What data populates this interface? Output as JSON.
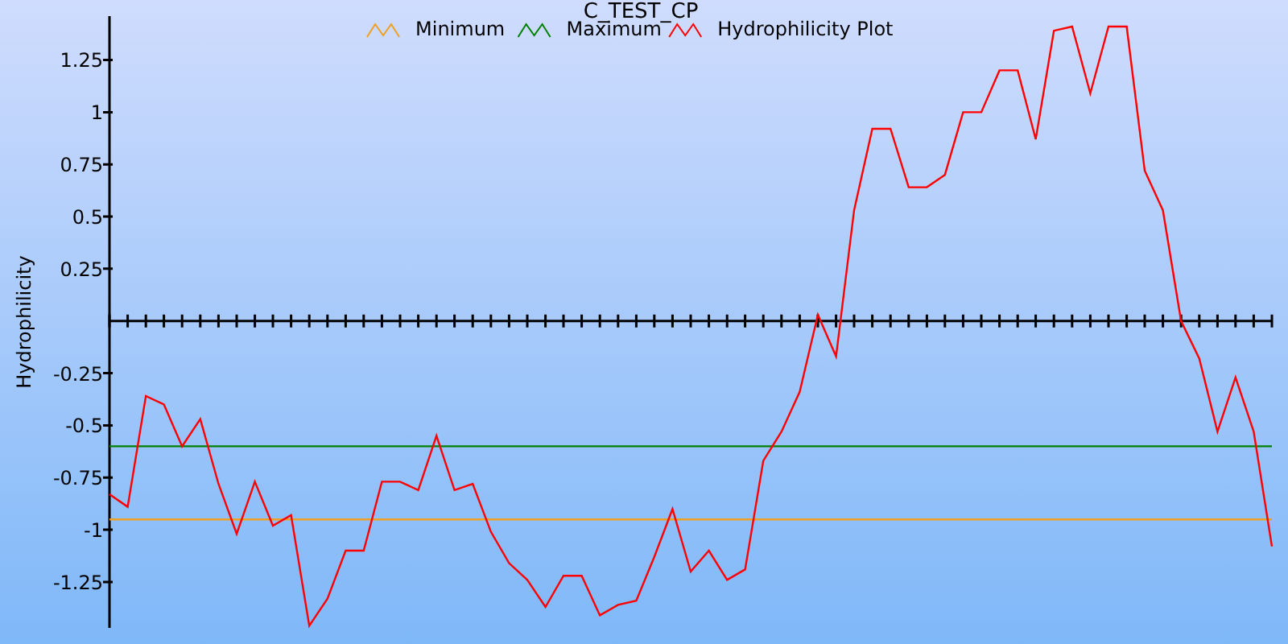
{
  "chart": {
    "chart_data": {
      "type": "line",
      "title": "C_TEST_CP",
      "legend": true,
      "ylabel": "Hydrophilicity",
      "ylim": [
        -1.47,
        1.46
      ],
      "yticks": [
        1.25,
        1,
        0.75,
        0.5,
        0.25,
        -0.25,
        -0.5,
        -0.75,
        -1,
        -1.25
      ],
      "series": [
        {
          "name": "Minimum",
          "color": "#f0a020",
          "values": [
            -0.95,
            -0.95,
            -0.95,
            -0.95,
            -0.95,
            -0.95,
            -0.95,
            -0.95,
            -0.95,
            -0.95,
            -0.95,
            -0.95,
            -0.95,
            -0.95,
            -0.95,
            -0.95,
            -0.95,
            -0.95,
            -0.95,
            -0.95,
            -0.95,
            -0.95,
            -0.95,
            -0.95,
            -0.95,
            -0.95,
            -0.95,
            -0.95,
            -0.95,
            -0.95,
            -0.95,
            -0.95,
            -0.95,
            -0.95,
            -0.95,
            -0.95,
            -0.95,
            -0.95,
            -0.95,
            -0.95,
            -0.95,
            -0.95,
            -0.95,
            -0.95,
            -0.95,
            -0.95,
            -0.95,
            -0.95,
            -0.95,
            -0.95,
            -0.95,
            -0.95,
            -0.95,
            -0.95,
            -0.95,
            -0.95,
            -0.95,
            -0.95,
            -0.95,
            -0.95,
            -0.95,
            -0.95,
            -0.95,
            -0.95,
            -0.95
          ]
        },
        {
          "name": "Maximum",
          "color": "#008000",
          "values": [
            -0.6,
            -0.6,
            -0.6,
            -0.6,
            -0.6,
            -0.6,
            -0.6,
            -0.6,
            -0.6,
            -0.6,
            -0.6,
            -0.6,
            -0.6,
            -0.6,
            -0.6,
            -0.6,
            -0.6,
            -0.6,
            -0.6,
            -0.6,
            -0.6,
            -0.6,
            -0.6,
            -0.6,
            -0.6,
            -0.6,
            -0.6,
            -0.6,
            -0.6,
            -0.6,
            -0.6,
            -0.6,
            -0.6,
            -0.6,
            -0.6,
            -0.6,
            -0.6,
            -0.6,
            -0.6,
            -0.6,
            -0.6,
            -0.6,
            -0.6,
            -0.6,
            -0.6,
            -0.6,
            -0.6,
            -0.6,
            -0.6,
            -0.6,
            -0.6,
            -0.6,
            -0.6,
            -0.6,
            -0.6,
            -0.6,
            -0.6,
            -0.6,
            -0.6,
            -0.6,
            -0.6,
            -0.6,
            -0.6,
            -0.6,
            -0.6
          ]
        },
        {
          "name": "Hydrophilicity Plot",
          "color": "#ff0000",
          "values": [
            -0.83,
            -0.89,
            -0.36,
            -0.4,
            -0.6,
            -0.47,
            -0.78,
            -1.02,
            -0.77,
            -0.98,
            -0.93,
            -1.46,
            -1.33,
            -1.1,
            -1.1,
            -0.77,
            -0.77,
            -0.81,
            -0.55,
            -0.81,
            -0.78,
            -1.01,
            -1.16,
            -1.24,
            -1.37,
            -1.22,
            -1.22,
            -1.41,
            -1.36,
            -1.34,
            -1.13,
            -0.9,
            -1.2,
            -1.1,
            -1.24,
            -1.19,
            -0.67,
            -0.53,
            -0.34,
            0.03,
            -0.17,
            0.53,
            0.92,
            0.92,
            0.64,
            0.64,
            0.7,
            1.0,
            1.0,
            1.2,
            1.2,
            0.87,
            1.39,
            1.41,
            1.09,
            1.41,
            1.41,
            0.72,
            0.53,
            0.0,
            -0.18,
            -0.53,
            -0.27,
            -0.53,
            -1.08
          ]
        }
      ]
    }
  }
}
